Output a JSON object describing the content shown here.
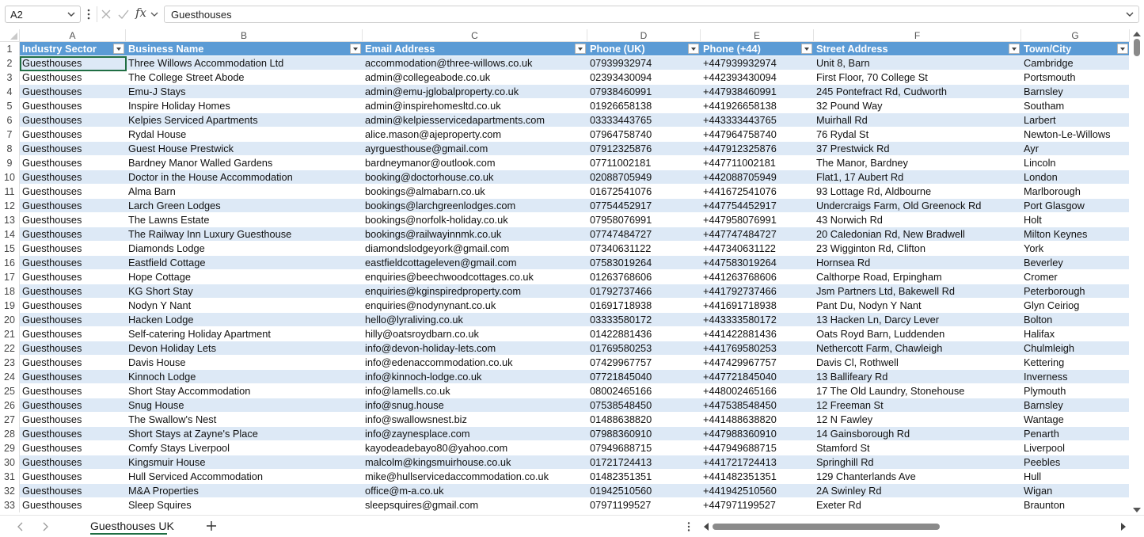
{
  "formula_bar": {
    "name_box": "A2",
    "value": "Guesthouses"
  },
  "columns": {
    "letters": [
      "A",
      "B",
      "C",
      "D",
      "E",
      "F",
      "G"
    ],
    "headers": [
      "Industry Sector",
      "Business Name",
      "Email Address",
      "Phone (UK)",
      "Phone (+44)",
      "Street Address",
      "Town/City"
    ]
  },
  "header_row_number": "1",
  "rows": [
    {
      "n": "2",
      "cells": [
        "Guesthouses",
        "Three Willows Accommodation Ltd",
        "accommodation@three-willows.co.uk",
        "07939932974",
        "+447939932974",
        "Unit 8, Barn",
        "Cambridge"
      ]
    },
    {
      "n": "3",
      "cells": [
        "Guesthouses",
        "The College Street Abode",
        "admin@collegeabode.co.uk",
        "02393430094",
        "+442393430094",
        "First Floor, 70 College St",
        "Portsmouth"
      ]
    },
    {
      "n": "4",
      "cells": [
        "Guesthouses",
        "Emu-J Stays",
        "admin@emu-jglobalproperty.co.uk",
        "07938460991",
        "+447938460991",
        "245 Pontefract Rd, Cudworth",
        "Barnsley"
      ]
    },
    {
      "n": "5",
      "cells": [
        "Guesthouses",
        "Inspire Holiday Homes",
        "admin@inspirehomesltd.co.uk",
        "01926658138",
        "+441926658138",
        "32 Pound Way",
        "Southam"
      ]
    },
    {
      "n": "6",
      "cells": [
        "Guesthouses",
        "Kelpies Serviced Apartments",
        "admin@kelpiesservicedapartments.com",
        "03333443765",
        "+443333443765",
        "Muirhall Rd",
        "Larbert"
      ]
    },
    {
      "n": "7",
      "cells": [
        "Guesthouses",
        "Rydal House",
        "alice.mason@ajeproperty.com",
        "07964758740",
        "+447964758740",
        "76 Rydal St",
        "Newton-Le-Willows"
      ]
    },
    {
      "n": "8",
      "cells": [
        "Guesthouses",
        "Guest House Prestwick",
        "ayrguesthouse@gmail.com",
        "07912325876",
        "+447912325876",
        "37 Prestwick Rd",
        "Ayr"
      ]
    },
    {
      "n": "9",
      "cells": [
        "Guesthouses",
        "Bardney Manor Walled Gardens",
        "bardneymanor@outlook.com",
        "07711002181",
        "+447711002181",
        "The Manor, Bardney",
        "Lincoln"
      ]
    },
    {
      "n": "10",
      "cells": [
        "Guesthouses",
        "Doctor in the House Accommodation",
        "booking@doctorhouse.co.uk",
        "02088705949",
        "+442088705949",
        "Flat1, 17 Aubert Rd",
        "London"
      ]
    },
    {
      "n": "11",
      "cells": [
        "Guesthouses",
        "Alma Barn",
        "bookings@almabarn.co.uk",
        "01672541076",
        "+441672541076",
        "93 Lottage Rd, Aldbourne",
        "Marlborough"
      ]
    },
    {
      "n": "12",
      "cells": [
        "Guesthouses",
        "Larch Green Lodges",
        "bookings@larchgreenlodges.com",
        "07754452917",
        "+447754452917",
        "Undercraigs Farm, Old Greenock Rd",
        "Port Glasgow"
      ]
    },
    {
      "n": "13",
      "cells": [
        "Guesthouses",
        "The Lawns Estate",
        "bookings@norfolk-holiday.co.uk",
        "07958076991",
        "+447958076991",
        "43 Norwich Rd",
        "Holt"
      ]
    },
    {
      "n": "14",
      "cells": [
        "Guesthouses",
        "The Railway Inn Luxury Guesthouse",
        "bookings@railwayinnmk.co.uk",
        "07747484727",
        "+447747484727",
        "20 Caledonian Rd, New Bradwell",
        "Milton Keynes"
      ]
    },
    {
      "n": "15",
      "cells": [
        "Guesthouses",
        "Diamonds Lodge",
        "diamondslodgeyork@gmail.com",
        "07340631122",
        "+447340631122",
        "23 Wigginton Rd, Clifton",
        "York"
      ]
    },
    {
      "n": "16",
      "cells": [
        "Guesthouses",
        "Eastfield Cottage",
        "eastfieldcottageleven@gmail.com",
        "07583019264",
        "+447583019264",
        "Hornsea Rd",
        "Beverley"
      ]
    },
    {
      "n": "17",
      "cells": [
        "Guesthouses",
        "Hope Cottage",
        "enquiries@beechwoodcottages.co.uk",
        "01263768606",
        "+441263768606",
        "Calthorpe Road, Erpingham",
        "Cromer"
      ]
    },
    {
      "n": "18",
      "cells": [
        "Guesthouses",
        "KG Short Stay",
        "enquiries@kginspiredproperty.com",
        "01792737466",
        "+441792737466",
        "Jsm Partners Ltd, Bakewell Rd",
        "Peterborough"
      ]
    },
    {
      "n": "19",
      "cells": [
        "Guesthouses",
        "Nodyn Y Nant",
        "enquiries@nodynynant.co.uk",
        "01691718938",
        "+441691718938",
        "Pant Du, Nodyn Y Nant",
        "Glyn Ceiriog"
      ]
    },
    {
      "n": "20",
      "cells": [
        "Guesthouses",
        "Hacken Lodge",
        "hello@lyraliving.co.uk",
        "03333580172",
        "+443333580172",
        "13 Hacken Ln, Darcy Lever",
        "Bolton"
      ]
    },
    {
      "n": "21",
      "cells": [
        "Guesthouses",
        "Self-catering Holiday Apartment",
        "hilly@oatsroydbarn.co.uk",
        "01422881436",
        "+441422881436",
        "Oats Royd Barn, Luddenden",
        "Halifax"
      ]
    },
    {
      "n": "22",
      "cells": [
        "Guesthouses",
        "Devon Holiday Lets",
        "info@devon-holiday-lets.com",
        "01769580253",
        "+441769580253",
        "Nethercott Farm, Chawleigh",
        "Chulmleigh"
      ]
    },
    {
      "n": "23",
      "cells": [
        "Guesthouses",
        "Davis House",
        "info@edenaccommodation.co.uk",
        "07429967757",
        "+447429967757",
        "Davis Cl, Rothwell",
        "Kettering"
      ]
    },
    {
      "n": "24",
      "cells": [
        "Guesthouses",
        "Kinnoch Lodge",
        "info@kinnoch-lodge.co.uk",
        "07721845040",
        "+447721845040",
        "13 Ballifeary Rd",
        "Inverness"
      ]
    },
    {
      "n": "25",
      "cells": [
        "Guesthouses",
        "Short Stay Accommodation",
        "info@lamells.co.uk",
        "08002465166",
        "+448002465166",
        "17 The Old Laundry, Stonehouse",
        "Plymouth"
      ]
    },
    {
      "n": "26",
      "cells": [
        "Guesthouses",
        "Snug House",
        "info@snug.house",
        "07538548450",
        "+447538548450",
        "12 Freeman St",
        "Barnsley"
      ]
    },
    {
      "n": "27",
      "cells": [
        "Guesthouses",
        "The Swallow's Nest",
        "info@swallowsnest.biz",
        "01488638820",
        "+441488638820",
        "12 N Fawley",
        "Wantage"
      ]
    },
    {
      "n": "28",
      "cells": [
        "Guesthouses",
        "Short Stays at Zayne's Place",
        "info@zaynesplace.com",
        "07988360910",
        "+447988360910",
        "14 Gainsborough Rd",
        "Penarth"
      ]
    },
    {
      "n": "29",
      "cells": [
        "Guesthouses",
        "Comfy Stays Liverpool",
        "kayodeadebayo80@yahoo.com",
        "07949688715",
        "+447949688715",
        "Stamford St",
        "Liverpool"
      ]
    },
    {
      "n": "30",
      "cells": [
        "Guesthouses",
        "Kingsmuir House",
        "malcolm@kingsmuirhouse.co.uk",
        "01721724413",
        "+441721724413",
        "Springhill Rd",
        "Peebles"
      ]
    },
    {
      "n": "31",
      "cells": [
        "Guesthouses",
        "Hull Serviced Accommodation",
        "mike@hullservicedaccommodation.co.uk",
        "01482351351",
        "+441482351351",
        "129 Chanterlands Ave",
        "Hull"
      ]
    },
    {
      "n": "32",
      "cells": [
        "Guesthouses",
        "M&A Properties",
        "office@m-a.co.uk",
        "01942510560",
        "+441942510560",
        "2A Swinley Rd",
        "Wigan"
      ]
    },
    {
      "n": "33",
      "cells": [
        "Guesthouses",
        "Sleep Squires",
        "sleepsquires@gmail.com",
        "07971199527",
        "+447971199527",
        "Exeter Rd",
        "Braunton"
      ]
    }
  ],
  "sheet_tab": "Guesthouses UK",
  "colors": {
    "header_fill": "#5b9bd5",
    "band_fill": "#dde9f6",
    "selection": "#1f6e43"
  },
  "icons": [
    "chevron-down-icon",
    "more-vertical-icon",
    "cancel-icon",
    "check-icon",
    "fx-icon",
    "expand-icon",
    "prev-sheet-icon",
    "next-sheet-icon",
    "add-sheet-icon"
  ]
}
